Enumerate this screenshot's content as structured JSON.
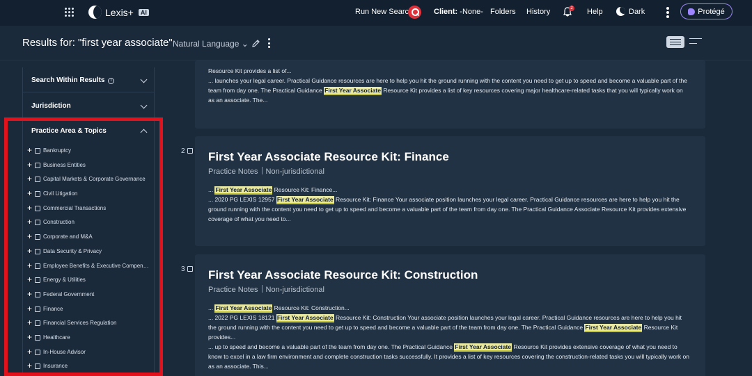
{
  "nav": {
    "logo_text": "Lexis+",
    "logo_ai": "AI",
    "run_search": "Run New Search",
    "client_label": "Client:",
    "client_value": "-None-",
    "folders": "Folders",
    "history": "History",
    "notification_count": "2",
    "help": "Help",
    "dark": "Dark",
    "protege": "Protégé"
  },
  "subheader": {
    "results_title": "Results for: \"first year associate\"",
    "search_mode": "Natural Language"
  },
  "sidebar": {
    "search_within": "Search Within Results",
    "jurisdiction": "Jurisdiction",
    "practice_area": "Practice Area & Topics",
    "topics": [
      "Bankruptcy",
      "Business Entities",
      "Capital Markets & Corporate Governance",
      "Civil Litigation",
      "Commercial Transactions",
      "Construction",
      "Corporate and M&A",
      "Data Security & Privacy",
      "Employee Benefits & Executive Compens...",
      "Energy & Utilities",
      "Federal Government",
      "Finance",
      "Financial Services Regulation",
      "Healthcare",
      "In-House Advisor",
      "Insurance"
    ]
  },
  "results": {
    "r1": {
      "s1": "Resource Kit provides a list of...",
      "s2a": "... launches your legal career. Practical Guidance resources are here to help you hit the ground running with the content you need to get up to speed and become a valuable part of the team from day one. The Practical Guidance ",
      "s2hl": "First Year Associate",
      "s2b": " Resource Kit provides a list of key resources covering major healthcare-related tasks that you will typically work on as an associate. The..."
    },
    "r2": {
      "num": "2",
      "title": "First Year Associate Resource Kit: Finance",
      "type": "Practice Notes",
      "jurisdiction": "Non-jurisdictional",
      "s1a": "... ",
      "s1hl": "First Year Associate",
      "s1b": " Resource Kit: Finance...",
      "s2a": "... 2020 PG LEXIS 12957 ",
      "s2hl": "First Year Associate",
      "s2b": " Resource Kit: Finance Your associate position launches your legal career. Practical Guidance resources are here to help you hit the ground running with the content you need to get up to speed and become a valuable part of the team from day one. The Practical Guidance Associate Resource Kit provides extensive coverage of what you need to..."
    },
    "r3": {
      "num": "3",
      "title": "First Year Associate Resource Kit: Construction",
      "type": "Practice Notes",
      "jurisdiction": "Non-jurisdictional",
      "s1a": "... ",
      "s1hl": "First Year Associate",
      "s1b": " Resource Kit: Construction...",
      "s2a": "... 2022 PG LEXIS 18121 ",
      "s2hl": "First Year Associate",
      "s2b": " Resource Kit: Construction Your associate position launches your legal career. Practical Guidance resources are here to help you hit the ground running with the content you need to get up to speed and become a valuable part of the team from day one. The Practical Guidance ",
      "s2hl2": "First Year Associate",
      "s2c": " Resource Kit provides...",
      "s3a": "... up to speed and become a valuable part of the team from day one. The Practical Guidance ",
      "s3hl": "First Year Associate",
      "s3b": " Resource Kit provides extensive coverage of what you need to know to excel in a law firm environment and complete construction tasks successfully. It provides a list of key resources covering the construction-related tasks you will typically work on as an associate. This..."
    }
  },
  "colors": {
    "nav_bg": "#12202f",
    "page_bg": "#1b2a3b",
    "card_bg": "#213244",
    "highlight": "#e9e8a0",
    "accent_red": "#e1121c",
    "protege_purple": "#9d85ff"
  }
}
